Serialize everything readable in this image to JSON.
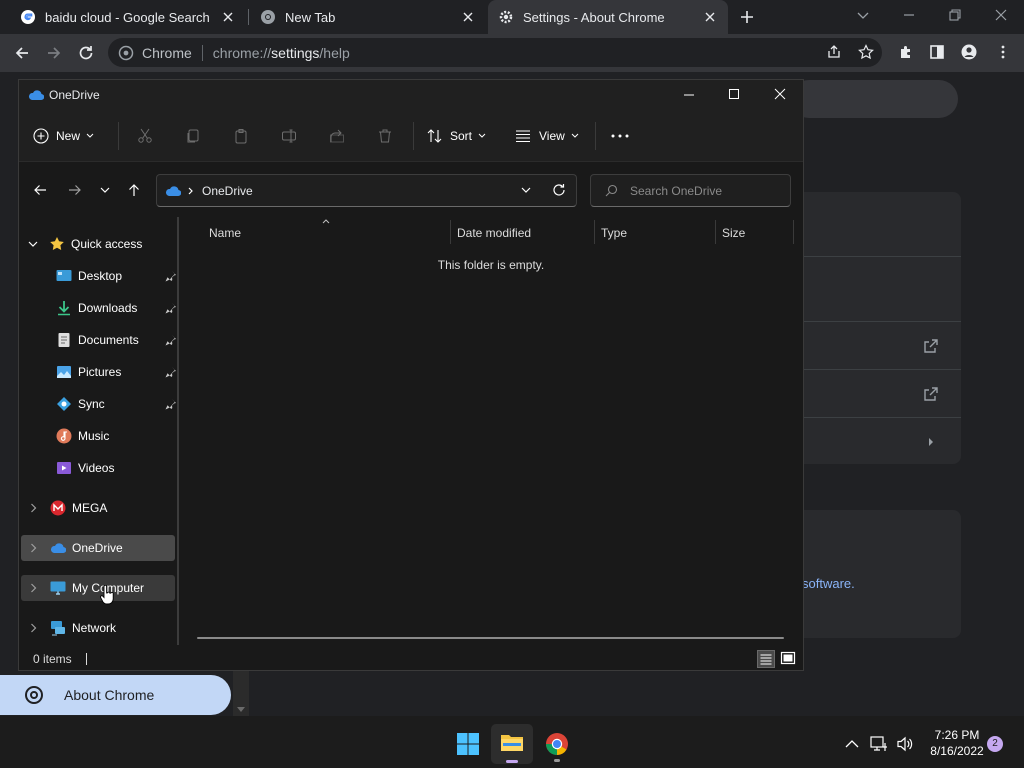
{
  "chrome": {
    "tabs": [
      {
        "title": "baidu cloud - Google Search",
        "icon": "google-icon"
      },
      {
        "title": "New Tab",
        "icon": "chrome-icon"
      },
      {
        "title": "Settings - About Chrome",
        "icon": "gear-icon"
      }
    ],
    "omnibox": {
      "site_label": "Chrome",
      "url_prefix": "chrome://",
      "url_host": "settings",
      "url_path": "/help"
    },
    "sidebar_active": "About Chrome",
    "page_fragment": "software."
  },
  "explorer": {
    "title": "OneDrive",
    "commands": {
      "new": "New",
      "sort": "Sort",
      "view": "View",
      "more": "..."
    },
    "address": {
      "location": "OneDrive",
      "search_placeholder": "Search OneDrive"
    },
    "nav": {
      "quick_access": "Quick access",
      "pinned": [
        {
          "label": "Desktop",
          "icon": "desktop-icon",
          "pinned": true
        },
        {
          "label": "Downloads",
          "icon": "download-icon",
          "pinned": true
        },
        {
          "label": "Documents",
          "icon": "document-icon",
          "pinned": true
        },
        {
          "label": "Pictures",
          "icon": "pictures-icon",
          "pinned": true
        },
        {
          "label": "Sync",
          "icon": "sync-icon",
          "pinned": true
        },
        {
          "label": "Music",
          "icon": "music-icon",
          "pinned": false
        },
        {
          "label": "Videos",
          "icon": "video-icon",
          "pinned": false
        }
      ],
      "roots": [
        {
          "label": "MEGA",
          "icon": "mega-icon"
        },
        {
          "label": "OneDrive",
          "icon": "cloud-icon",
          "selected": true
        },
        {
          "label": "My Computer",
          "icon": "monitor-icon",
          "hover": true
        },
        {
          "label": "Network",
          "icon": "network-icon"
        }
      ]
    },
    "columns": [
      "Name",
      "Date modified",
      "Type",
      "Size"
    ],
    "empty_message": "This folder is empty.",
    "status": "0 items"
  },
  "taskbar": {
    "time": "7:26 PM",
    "date": "8/16/2022",
    "notifications": "2"
  },
  "colors": {
    "accent": "#c2d7f6",
    "link": "#8ab4f8",
    "folder": "#f4c542",
    "onedrive": "#3a8ee6"
  }
}
